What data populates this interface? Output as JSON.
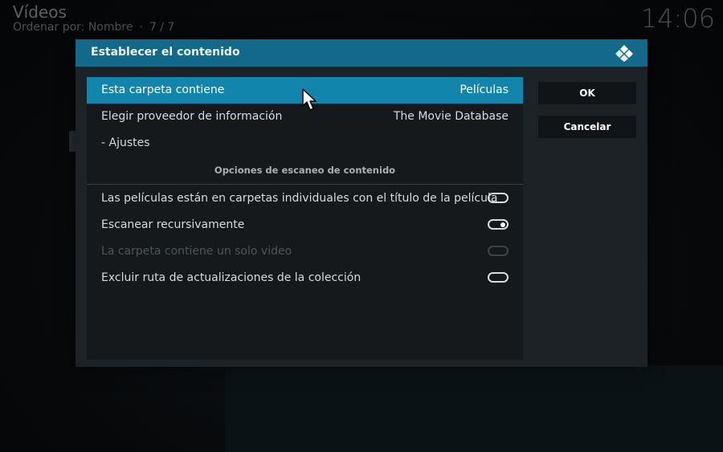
{
  "background": {
    "title": "Vídeos",
    "sort_label": "Ordenar por: Nombre",
    "sort_separator": "·",
    "position": "7 / 7",
    "clock": "14:06"
  },
  "dialog": {
    "title": "Establecer el contenido",
    "rows": [
      {
        "label": "Esta carpeta contiene",
        "value": "Películas"
      },
      {
        "label": "Elegir proveedor de información",
        "value": "The Movie Database"
      },
      {
        "label": "- Ajustes"
      }
    ],
    "section_title": "Opciones de escaneo de contenido",
    "options": [
      {
        "label": "Las películas están en carpetas individuales con el título de la película",
        "state": "off"
      },
      {
        "label": "Escanear recursivamente",
        "state": "on"
      },
      {
        "label": "La carpeta contiene un solo video",
        "state": "disabled"
      },
      {
        "label": "Excluir ruta de actualizaciones de la colección",
        "state": "off"
      }
    ],
    "ok_label": "OK",
    "cancel_label": "Cancelar"
  },
  "colors": {
    "header": "#13698a",
    "focus": "#1285ad",
    "panel": "#15191b"
  }
}
